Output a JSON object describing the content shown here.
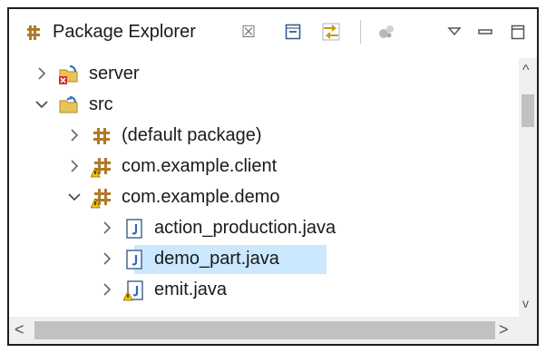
{
  "view": {
    "title": "Package Explorer",
    "close_glyph": "☒"
  },
  "toolbar": {
    "items": [
      {
        "name": "collapse-all-icon"
      },
      {
        "name": "link-with-editor-icon"
      },
      {
        "name": "focus-active-task-icon"
      },
      {
        "name": "view-menu-icon"
      },
      {
        "name": "minimize-icon"
      },
      {
        "name": "maximize-icon"
      }
    ]
  },
  "tree": {
    "rows": [
      {
        "label": "server",
        "icon": "project-error-icon",
        "expanded": false,
        "depth": 0
      },
      {
        "label": "src",
        "icon": "project-icon",
        "expanded": true,
        "depth": 0
      },
      {
        "label": "(default package)",
        "icon": "package-icon",
        "expanded": false,
        "depth": 1
      },
      {
        "label": "com.example.client",
        "icon": "package-warning-icon",
        "expanded": false,
        "depth": 1
      },
      {
        "label": "com.example.demo",
        "icon": "package-warning-icon",
        "expanded": true,
        "depth": 1
      },
      {
        "label": "action_production.java",
        "icon": "java-file-icon",
        "expanded": false,
        "depth": 2
      },
      {
        "label": "demo_part.java",
        "icon": "java-file-icon",
        "expanded": false,
        "depth": 2,
        "selected": true
      },
      {
        "label": "emit.java",
        "icon": "java-file-warning-icon",
        "expanded": false,
        "depth": 2
      }
    ]
  },
  "colors": {
    "selection": "#cce8ff",
    "scrollbar_track": "#f0f0f0",
    "scrollbar_thumb": "#c1c1c1",
    "package_brown": "#b07a2a",
    "warning_yellow": "#f2c200",
    "error_red": "#d32f2f"
  }
}
